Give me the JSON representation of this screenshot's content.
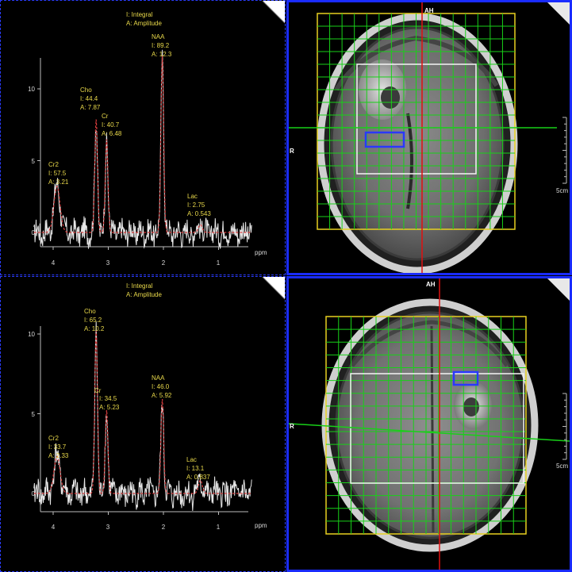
{
  "legend": {
    "line1": "I: Integral",
    "line2": "A: Amplitude"
  },
  "units": {
    "ppm": "ppm",
    "scale": "5cm"
  },
  "orient": {
    "top": "AH",
    "side": "R"
  },
  "colors": {
    "integral_fit": "#d43b3b",
    "spectrum": "#e6e6e6",
    "grid": "#18d018",
    "roi": "#e8d020",
    "voxel": "#2a38ff",
    "slice_line": "#e01010"
  },
  "chart_data": [
    {
      "type": "line",
      "x_axis": {
        "reversed": true,
        "ticks": [
          "4",
          "3",
          "2",
          "1"
        ],
        "label": "ppm"
      },
      "y_axis": {
        "ticks": [
          "10",
          "5",
          "0"
        ],
        "range": [
          -1,
          12
        ]
      },
      "peaks": [
        {
          "name": "Cr2",
          "ppm": 3.93,
          "integral": "57.5",
          "amplitude": "3.21",
          "amp": 3.21
        },
        {
          "name": "Cho",
          "ppm": 3.22,
          "integral": "44.4",
          "amplitude": "7.87",
          "amp": 7.87
        },
        {
          "name": "Cr",
          "ppm": 3.03,
          "integral": "40.7",
          "amplitude": "6.48",
          "amp": 6.48
        },
        {
          "name": "NAA",
          "ppm": 2.02,
          "integral": "89.2",
          "amplitude": "12.3",
          "amp": 12.3
        },
        {
          "name": "Lac",
          "ppm": 1.33,
          "integral": "2.75",
          "amplitude": "0.543",
          "amp": 0.543
        }
      ]
    },
    {
      "type": "line",
      "x_axis": {
        "reversed": true,
        "ticks": [
          "4",
          "3",
          "2",
          "1"
        ],
        "label": "ppm"
      },
      "y_axis": {
        "ticks": [
          "10",
          "5",
          "0"
        ],
        "range": [
          -1,
          10.5
        ]
      },
      "peaks": [
        {
          "name": "Cr2",
          "ppm": 3.93,
          "integral": "33.7",
          "amplitude": "2.33",
          "amp": 2.33
        },
        {
          "name": "Cho",
          "ppm": 3.22,
          "integral": "65.2",
          "amplitude": "10.2",
          "amp": 10.2
        },
        {
          "name": "Cr",
          "ppm": 3.03,
          "integral": "34.5",
          "amplitude": "5.23",
          "amp": 5.23
        },
        {
          "name": "NAA",
          "ppm": 2.02,
          "integral": "46.0",
          "amplitude": "5.92",
          "amp": 5.92
        },
        {
          "name": "Lac",
          "ppm": 1.33,
          "integral": "13.1",
          "amplitude": "0.837",
          "amp": 0.837
        }
      ]
    }
  ]
}
